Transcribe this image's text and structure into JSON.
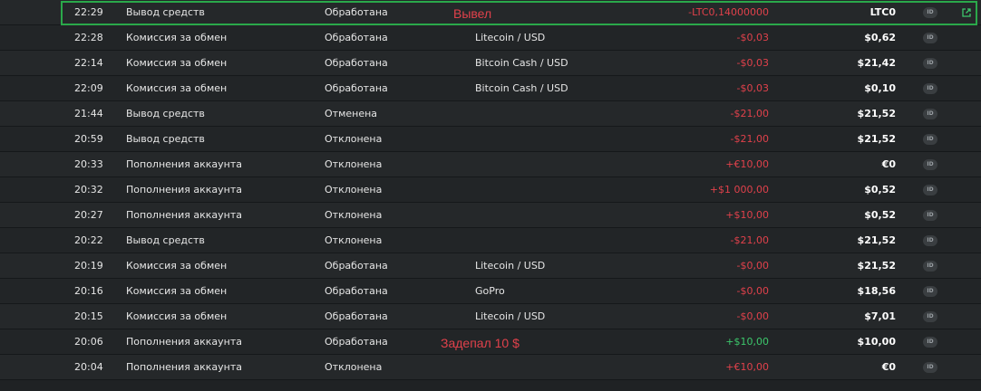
{
  "rows": [
    {
      "time": "22:29",
      "type": "Вывод средств",
      "status": "Обработана",
      "pair": "",
      "amount": "-LTC0,14000000",
      "amount_color": "neg",
      "balance": "LTC0",
      "id": "ID"
    },
    {
      "time": "22:28",
      "type": "Комиссия за обмен",
      "status": "Обработана",
      "pair": "Litecoin / USD",
      "amount": "-$0,03",
      "amount_color": "neg",
      "balance": "$0,62",
      "id": "ID"
    },
    {
      "time": "22:14",
      "type": "Комиссия за обмен",
      "status": "Обработана",
      "pair": "Bitcoin Cash / USD",
      "amount": "-$0,03",
      "amount_color": "neg",
      "balance": "$21,42",
      "id": "ID"
    },
    {
      "time": "22:09",
      "type": "Комиссия за обмен",
      "status": "Обработана",
      "pair": "Bitcoin Cash / USD",
      "amount": "-$0,03",
      "amount_color": "neg",
      "balance": "$0,10",
      "id": "ID"
    },
    {
      "time": "21:44",
      "type": "Вывод средств",
      "status": "Отменена",
      "pair": "",
      "amount": "-$21,00",
      "amount_color": "neg",
      "balance": "$21,52",
      "id": "ID"
    },
    {
      "time": "20:59",
      "type": "Вывод средств",
      "status": "Отклонена",
      "pair": "",
      "amount": "-$21,00",
      "amount_color": "neg",
      "balance": "$21,52",
      "id": "ID"
    },
    {
      "time": "20:33",
      "type": "Пополнения аккаунта",
      "status": "Отклонена",
      "pair": "",
      "amount": "+€10,00",
      "amount_color": "pos-red",
      "balance": "€0",
      "id": "ID"
    },
    {
      "time": "20:32",
      "type": "Пополнения аккаунта",
      "status": "Отклонена",
      "pair": "",
      "amount": "+$1 000,00",
      "amount_color": "pos-red",
      "balance": "$0,52",
      "id": "ID"
    },
    {
      "time": "20:27",
      "type": "Пополнения аккаунта",
      "status": "Отклонена",
      "pair": "",
      "amount": "+$10,00",
      "amount_color": "pos-red",
      "balance": "$0,52",
      "id": "ID"
    },
    {
      "time": "20:22",
      "type": "Вывод средств",
      "status": "Отклонена",
      "pair": "",
      "amount": "-$21,00",
      "amount_color": "neg",
      "balance": "$21,52",
      "id": "ID"
    },
    {
      "time": "20:19",
      "type": "Комиссия за обмен",
      "status": "Обработана",
      "pair": "Litecoin / USD",
      "amount": "-$0,00",
      "amount_color": "neg",
      "balance": "$21,52",
      "id": "ID"
    },
    {
      "time": "20:16",
      "type": "Комиссия за обмен",
      "status": "Обработана",
      "pair": "GoPro",
      "amount": "-$0,00",
      "amount_color": "neg",
      "balance": "$18,56",
      "id": "ID"
    },
    {
      "time": "20:15",
      "type": "Комиссия за обмен",
      "status": "Обработана",
      "pair": "Litecoin / USD",
      "amount": "-$0,00",
      "amount_color": "neg",
      "balance": "$7,01",
      "id": "ID"
    },
    {
      "time": "20:06",
      "type": "Пополнения аккаунта",
      "status": "Обработана",
      "pair": "",
      "amount": "+$10,00",
      "amount_color": "pos-green",
      "balance": "$10,00",
      "id": "ID"
    },
    {
      "time": "20:04",
      "type": "Пополнения аккаунта",
      "status": "Отклонена",
      "pair": "",
      "amount": "+€10,00",
      "amount_color": "pos-red",
      "balance": "€0",
      "id": "ID"
    }
  ],
  "annotations": {
    "withdrew": "Вывел",
    "deposited": "Задепал 10 $"
  },
  "icons": {
    "external_link": "external-link-icon"
  },
  "colors": {
    "negative": "#e0414b",
    "positive": "#3cc76b",
    "highlight_border": "#2aa84a"
  }
}
